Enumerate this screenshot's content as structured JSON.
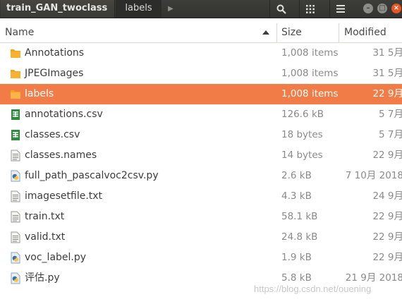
{
  "header": {
    "breadcrumb_prev": "train_GAN_twoclass",
    "breadcrumb_current": "labels",
    "min_label": "–",
    "max_label": "□",
    "close_label": "×"
  },
  "columns": {
    "name": "Name",
    "size": "Size",
    "modified": "Modified"
  },
  "files": [
    {
      "name": "Annotations",
      "size": "1,008 items",
      "modified": "31 5月",
      "type": "folder"
    },
    {
      "name": "JPEGImages",
      "size": "1,008 items",
      "modified": "31 5月",
      "type": "folder"
    },
    {
      "name": "labels",
      "size": "1,008 items",
      "modified": "22 9月",
      "type": "folder",
      "selected": true
    },
    {
      "name": "annotations.csv",
      "size": "126.6 kB",
      "modified": "5 7月",
      "type": "spreadsheet"
    },
    {
      "name": "classes.csv",
      "size": "18 bytes",
      "modified": "5 7月",
      "type": "spreadsheet"
    },
    {
      "name": "classes.names",
      "size": "14 bytes",
      "modified": "22 9月",
      "type": "text"
    },
    {
      "name": "full_path_pascalvoc2csv.py",
      "size": "2.6 kB",
      "modified": "7 10月 2018",
      "type": "python"
    },
    {
      "name": "imagesetfile.txt",
      "size": "4.3 kB",
      "modified": "24 9月",
      "type": "text"
    },
    {
      "name": "train.txt",
      "size": "58.1 kB",
      "modified": "22 9月",
      "type": "text"
    },
    {
      "name": "valid.txt",
      "size": "24.8 kB",
      "modified": "22 9月",
      "type": "text"
    },
    {
      "name": "voc_label.py",
      "size": "1.9 kB",
      "modified": "22 9月",
      "type": "python"
    },
    {
      "name": "评估.py",
      "size": "5.8 kB",
      "modified": "21 9月 2018",
      "type": "python"
    }
  ],
  "watermark": "https://blog.csdn.net/ouening",
  "colors": {
    "selection": "#f27c47",
    "folder": "#f6a31c",
    "spreadsheet": "#2e8b3d",
    "python": "#3b6ea5"
  }
}
